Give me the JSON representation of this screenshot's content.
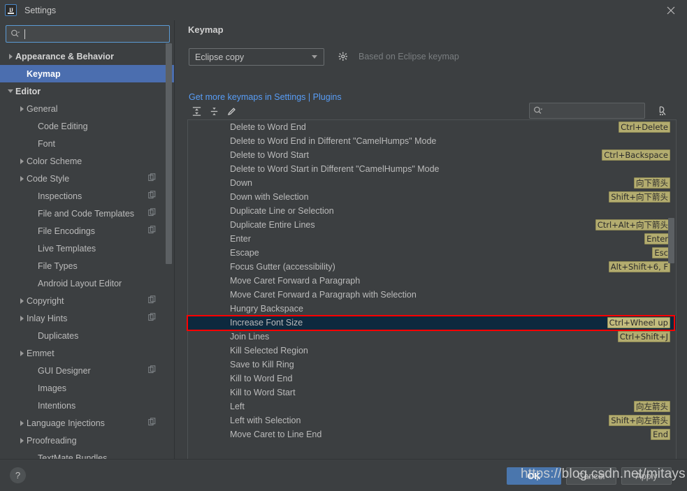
{
  "window": {
    "title": "Settings",
    "app_icon": "intellij-idea-icon",
    "close_icon": "close-icon"
  },
  "sidebar": {
    "search": {
      "placeholder": "",
      "value": "",
      "icon": "search-icon"
    },
    "items": [
      {
        "label": "Appearance & Behavior",
        "arrow": "right",
        "bold": true,
        "indent": 0,
        "copy": false,
        "selected": false
      },
      {
        "label": "Keymap",
        "arrow": "none",
        "bold": true,
        "indent": 1,
        "copy": false,
        "selected": true
      },
      {
        "label": "Editor",
        "arrow": "down",
        "bold": true,
        "indent": 0,
        "copy": false,
        "selected": false
      },
      {
        "label": "General",
        "arrow": "right",
        "bold": false,
        "indent": 1,
        "copy": false,
        "selected": false
      },
      {
        "label": "Code Editing",
        "arrow": "none",
        "bold": false,
        "indent": 2,
        "copy": false,
        "selected": false
      },
      {
        "label": "Font",
        "arrow": "none",
        "bold": false,
        "indent": 2,
        "copy": false,
        "selected": false
      },
      {
        "label": "Color Scheme",
        "arrow": "right",
        "bold": false,
        "indent": 1,
        "copy": false,
        "selected": false
      },
      {
        "label": "Code Style",
        "arrow": "right",
        "bold": false,
        "indent": 1,
        "copy": true,
        "selected": false
      },
      {
        "label": "Inspections",
        "arrow": "none",
        "bold": false,
        "indent": 2,
        "copy": true,
        "selected": false
      },
      {
        "label": "File and Code Templates",
        "arrow": "none",
        "bold": false,
        "indent": 2,
        "copy": true,
        "selected": false
      },
      {
        "label": "File Encodings",
        "arrow": "none",
        "bold": false,
        "indent": 2,
        "copy": true,
        "selected": false
      },
      {
        "label": "Live Templates",
        "arrow": "none",
        "bold": false,
        "indent": 2,
        "copy": false,
        "selected": false
      },
      {
        "label": "File Types",
        "arrow": "none",
        "bold": false,
        "indent": 2,
        "copy": false,
        "selected": false
      },
      {
        "label": "Android Layout Editor",
        "arrow": "none",
        "bold": false,
        "indent": 2,
        "copy": false,
        "selected": false
      },
      {
        "label": "Copyright",
        "arrow": "right",
        "bold": false,
        "indent": 1,
        "copy": true,
        "selected": false
      },
      {
        "label": "Inlay Hints",
        "arrow": "right",
        "bold": false,
        "indent": 1,
        "copy": true,
        "selected": false
      },
      {
        "label": "Duplicates",
        "arrow": "none",
        "bold": false,
        "indent": 2,
        "copy": false,
        "selected": false
      },
      {
        "label": "Emmet",
        "arrow": "right",
        "bold": false,
        "indent": 1,
        "copy": false,
        "selected": false
      },
      {
        "label": "GUI Designer",
        "arrow": "none",
        "bold": false,
        "indent": 2,
        "copy": true,
        "selected": false
      },
      {
        "label": "Images",
        "arrow": "none",
        "bold": false,
        "indent": 2,
        "copy": false,
        "selected": false
      },
      {
        "label": "Intentions",
        "arrow": "none",
        "bold": false,
        "indent": 2,
        "copy": false,
        "selected": false
      },
      {
        "label": "Language Injections",
        "arrow": "right",
        "bold": false,
        "indent": 1,
        "copy": true,
        "selected": false
      },
      {
        "label": "Proofreading",
        "arrow": "right",
        "bold": false,
        "indent": 1,
        "copy": false,
        "selected": false
      },
      {
        "label": "TextMate Bundles",
        "arrow": "none",
        "bold": false,
        "indent": 2,
        "copy": false,
        "selected": false
      }
    ]
  },
  "keymap_pane": {
    "title": "Keymap",
    "keymap_select": {
      "value": "Eclipse copy",
      "options": [
        "Eclipse copy"
      ]
    },
    "gear_icon": "gear-icon",
    "based_on": "Based on Eclipse keymap",
    "plugins_link": "Get more keymaps in Settings | Plugins",
    "toolbar": {
      "expand_all": "expand-all-icon",
      "collapse_all": "collapse-all-icon",
      "edit": "edit-pencil-icon",
      "search": {
        "placeholder": "",
        "value": "",
        "icon": "search-icon"
      },
      "find_by_shortcut": "find-by-shortcut-icon"
    },
    "actions": [
      {
        "name": "Delete to Word End",
        "shortcut": "Ctrl+Delete",
        "selected": false
      },
      {
        "name": "Delete to Word End in Different \"CamelHumps\" Mode",
        "shortcut": "",
        "selected": false
      },
      {
        "name": "Delete to Word Start",
        "shortcut": "Ctrl+Backspace",
        "selected": false
      },
      {
        "name": "Delete to Word Start in Different \"CamelHumps\" Mode",
        "shortcut": "",
        "selected": false
      },
      {
        "name": "Down",
        "shortcut": "向下箭头",
        "selected": false
      },
      {
        "name": "Down with Selection",
        "shortcut": "Shift+向下箭头",
        "selected": false
      },
      {
        "name": "Duplicate Line or Selection",
        "shortcut": "",
        "selected": false
      },
      {
        "name": "Duplicate Entire Lines",
        "shortcut": "Ctrl+Alt+向下箭头",
        "selected": false
      },
      {
        "name": "Enter",
        "shortcut": "Enter",
        "selected": false
      },
      {
        "name": "Escape",
        "shortcut": "Esc",
        "selected": false
      },
      {
        "name": "Focus Gutter (accessibility)",
        "shortcut": "Alt+Shift+6, F",
        "selected": false
      },
      {
        "name": "Move Caret Forward a Paragraph",
        "shortcut": "",
        "selected": false
      },
      {
        "name": "Move Caret Forward a Paragraph with Selection",
        "shortcut": "",
        "selected": false
      },
      {
        "name": "Hungry Backspace",
        "shortcut": "",
        "selected": false
      },
      {
        "name": "Increase Font Size",
        "shortcut": "Ctrl+Wheel up",
        "selected": true
      },
      {
        "name": "Join Lines",
        "shortcut": "Ctrl+Shift+J",
        "selected": false
      },
      {
        "name": "Kill Selected Region",
        "shortcut": "",
        "selected": false
      },
      {
        "name": "Save to Kill Ring",
        "shortcut": "",
        "selected": false
      },
      {
        "name": "Kill to Word End",
        "shortcut": "",
        "selected": false
      },
      {
        "name": "Kill to Word Start",
        "shortcut": "",
        "selected": false
      },
      {
        "name": "Left",
        "shortcut": "向左箭头",
        "selected": false
      },
      {
        "name": "Left with Selection",
        "shortcut": "Shift+向左箭头",
        "selected": false
      },
      {
        "name": "Move Caret to Line End",
        "shortcut": "End",
        "selected": false
      }
    ]
  },
  "footer": {
    "help_label": "?",
    "ok_label": "OK",
    "cancel_label": "Cancel",
    "apply_label": "Apply"
  },
  "overlay": {
    "watermark": "https://blog.csdn.net/mitays",
    "highlight_color": "#fe0000"
  },
  "colors": {
    "background": "#3c3f41",
    "selection_blue": "#4b6eaf",
    "row_selection": "#0d293e",
    "shortcut_badge": "#b3ac6f",
    "link": "#589df6",
    "primary_button": "#4a76ad"
  }
}
